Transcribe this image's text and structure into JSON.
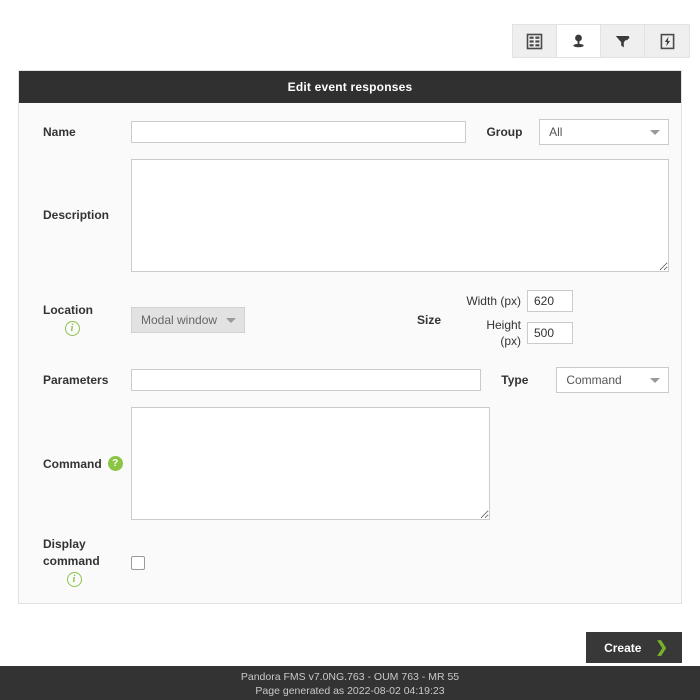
{
  "toolbar": {
    "buttons": [
      {
        "name": "list-view-icon",
        "label": "List view",
        "active": false
      },
      {
        "name": "user-icon",
        "label": "User",
        "active": true
      },
      {
        "name": "filter-edit-icon",
        "label": "Filter",
        "active": false
      },
      {
        "name": "lightning-icon",
        "label": "Events",
        "active": false
      }
    ]
  },
  "panel": {
    "title": "Edit event responses"
  },
  "form": {
    "name": {
      "label": "Name",
      "value": "",
      "placeholder": ""
    },
    "group": {
      "label": "Group",
      "value": "All"
    },
    "description": {
      "label": "Description",
      "value": "",
      "placeholder": ""
    },
    "location": {
      "label": "Location",
      "value": "Modal window"
    },
    "size": {
      "label": "Size",
      "width_label": "Width (px)",
      "width_value": "620",
      "height_label": "Height (px)",
      "height_value": "500"
    },
    "parameters": {
      "label": "Parameters",
      "value": "",
      "placeholder": ""
    },
    "type": {
      "label": "Type",
      "value": "Command"
    },
    "command": {
      "label": "Command",
      "value": "",
      "placeholder": ""
    },
    "display_command": {
      "label_line1": "Display",
      "label_line2": "command",
      "checked": false
    }
  },
  "actions": {
    "create_label": "Create",
    "create_chevron": "❯"
  },
  "footer": {
    "line1": "Pandora FMS v7.0NG.763 - OUM 763 - MR 55",
    "line2": "Page generated as 2022-08-02 04:19:23"
  },
  "colors": {
    "header_bar": "#303030",
    "accent_green": "#8ac544",
    "footer_bg": "#333333",
    "panel_bg": "#fafafa"
  }
}
